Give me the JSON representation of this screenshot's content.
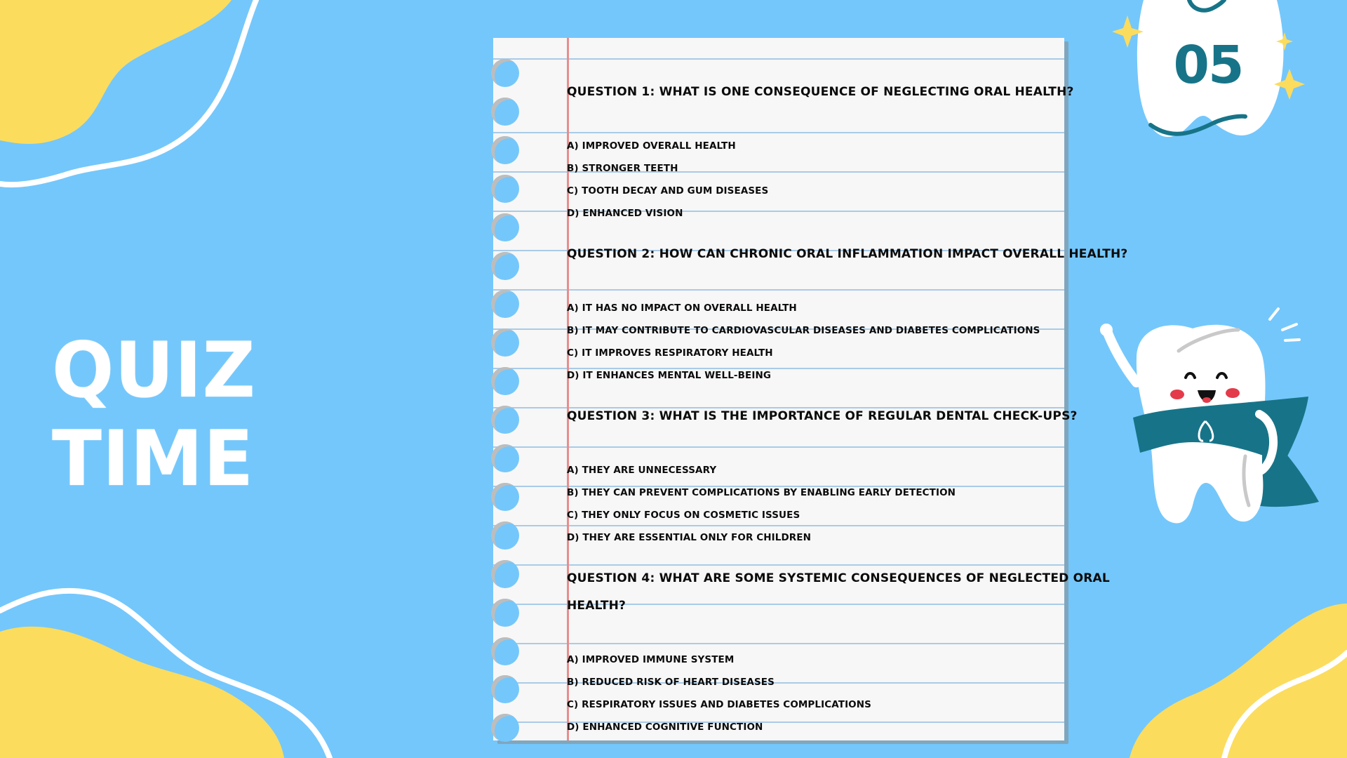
{
  "slide": {
    "title": "Quiz Time",
    "badge_number": "05",
    "colors": {
      "background": "#74c7fb",
      "blob": "#fcdc5d",
      "accent": "#177488",
      "paper": "#f7f7f7",
      "rule_line": "#a9cbe7",
      "margin_line": "#e88d8d"
    }
  },
  "quiz": {
    "questions": [
      {
        "prompt": "Question 1: What is one consequence of neglecting oral health?",
        "options": [
          "a) Improved overall health",
          "b) Stronger teeth",
          "c) Tooth decay and gum diseases",
          "d) Enhanced vision"
        ]
      },
      {
        "prompt": "Question 2: How can chronic oral inflammation impact overall health?",
        "options": [
          "a) It has no impact on overall health",
          "b) It may contribute to cardiovascular diseases and diabetes complications",
          "c) It improves respiratory health",
          "d) It enhances mental well-being"
        ]
      },
      {
        "prompt": "Question 3: What is the importance of regular dental check-ups?",
        "options": [
          "a) They are unnecessary",
          "b) They can prevent complications by enabling early detection",
          "c) They only focus on cosmetic issues",
          "d) They are essential only for children"
        ]
      },
      {
        "prompt_line1": "Question 4: What are some systemic consequences of neglected oral",
        "prompt_line2": "health?",
        "options": [
          "a) Improved immune system",
          "b) Reduced risk of heart diseases",
          "c) Respiratory issues and diabetes complications",
          "d) Enhanced cognitive function"
        ]
      }
    ]
  },
  "decorations": {
    "top_icon": "tooth-badge-icon",
    "mascot_icon": "tooth-superhero-icon",
    "sparkle_icon": "sparkle-icon"
  }
}
